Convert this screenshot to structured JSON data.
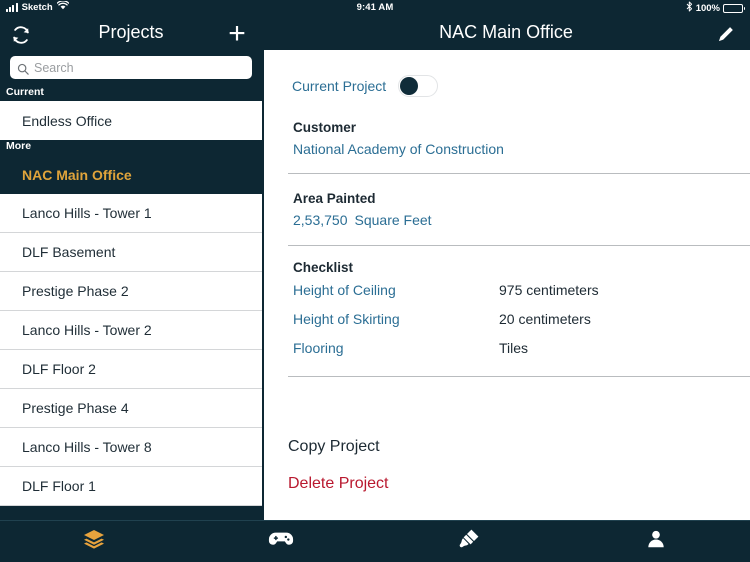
{
  "status_bar": {
    "carrier": "Sketch",
    "time": "9:41 AM",
    "battery_pct": "100%",
    "signal_icon": "signal-bars-icon",
    "wifi_icon": "wifi-icon",
    "bluetooth_icon": "bluetooth-icon",
    "battery_icon": "battery-full-icon"
  },
  "left_nav": {
    "title": "Projects",
    "refresh_icon": "refresh-icon",
    "add_icon": "plus-icon"
  },
  "right_nav": {
    "title": "NAC Main Office",
    "edit_icon": "pencil-icon"
  },
  "search": {
    "placeholder": "Search",
    "value": "",
    "icon": "search-icon"
  },
  "sidebar": {
    "sections": [
      {
        "header": "Current",
        "items": [
          {
            "label": "Endless Office",
            "selected": false
          }
        ]
      },
      {
        "header": "More",
        "items": [
          {
            "label": "NAC Main Office",
            "selected": true
          },
          {
            "label": "Lanco Hills - Tower 1",
            "selected": false
          },
          {
            "label": "DLF Basement",
            "selected": false
          },
          {
            "label": "Prestige Phase 2",
            "selected": false
          },
          {
            "label": "Lanco Hills - Tower 2",
            "selected": false
          },
          {
            "label": "DLF Floor 2",
            "selected": false
          },
          {
            "label": "Prestige Phase 4",
            "selected": false
          },
          {
            "label": "Lanco Hills - Tower 8",
            "selected": false
          },
          {
            "label": "DLF Floor 1",
            "selected": false
          }
        ]
      }
    ]
  },
  "detail": {
    "current_project": {
      "label": "Current Project",
      "toggle_on": false
    },
    "customer": {
      "label": "Customer",
      "value": "National Academy of Construction"
    },
    "area_painted": {
      "label": "Area Painted",
      "value": "2,53,750",
      "unit": "Square Feet"
    },
    "checklist": {
      "label": "Checklist",
      "rows": [
        {
          "key": "Height of Ceiling",
          "value": "975 centimeters"
        },
        {
          "key": "Height of Skirting",
          "value": "20 centimeters"
        },
        {
          "key": "Flooring",
          "value": "Tiles"
        }
      ]
    },
    "actions": {
      "copy": "Copy Project",
      "delete": "Delete Project"
    }
  },
  "tabbar": {
    "tabs": [
      {
        "name": "layers",
        "icon": "layers-icon",
        "active": true
      },
      {
        "name": "games",
        "icon": "game-controller-icon",
        "active": false
      },
      {
        "name": "paint",
        "icon": "paint-brush-icon",
        "active": false
      },
      {
        "name": "profile",
        "icon": "person-icon",
        "active": false
      }
    ]
  },
  "colors": {
    "navy": "#0d2733",
    "accent_gold": "#e0a43b",
    "link_blue": "#2b6e94",
    "danger_red": "#b9192f",
    "panel_white": "#ffffff"
  }
}
